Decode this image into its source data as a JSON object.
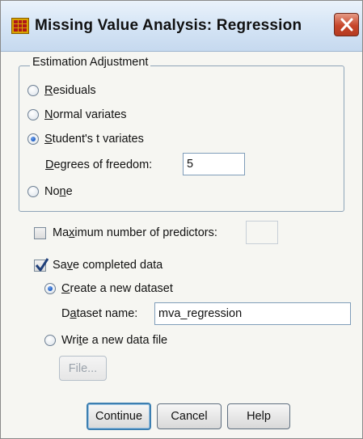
{
  "window": {
    "title": "Missing Value Analysis: Regression",
    "icon": "spss-grid-icon"
  },
  "estimation": {
    "legend": "Estimation Adjustment",
    "options": [
      {
        "pre": "",
        "u": "R",
        "post": "esiduals",
        "checked": false
      },
      {
        "pre": "",
        "u": "N",
        "post": "ormal variates",
        "checked": false
      },
      {
        "pre": "",
        "u": "S",
        "post": "tudent's t variates",
        "checked": true
      },
      {
        "pre": "No",
        "u": "n",
        "post": "e",
        "checked": false
      }
    ],
    "dof_label_u": "D",
    "dof_label_post": "egrees of freedom:",
    "dof_value": "5"
  },
  "max_predictors": {
    "label_pre": "Ma",
    "label_u": "x",
    "label_post": "imum number of predictors:",
    "checked": false,
    "value": ""
  },
  "save": {
    "label_pre": "Sa",
    "label_u": "v",
    "label_post": "e completed data",
    "checked": true,
    "create_pre": "",
    "create_u": "C",
    "create_post": "reate a new dataset",
    "create_checked": true,
    "dataset_label_pre": "D",
    "dataset_label_u": "a",
    "dataset_label_post": "taset name:",
    "dataset_value": "mva_regression",
    "write_pre": "Wri",
    "write_u": "t",
    "write_post": "e a new data file",
    "write_checked": false,
    "file_button": "File..."
  },
  "buttons": {
    "continue": "Continue",
    "cancel": "Cancel",
    "help": "Help"
  },
  "colors": {
    "accent": "#1f5fc4",
    "close": "#c6452a"
  }
}
